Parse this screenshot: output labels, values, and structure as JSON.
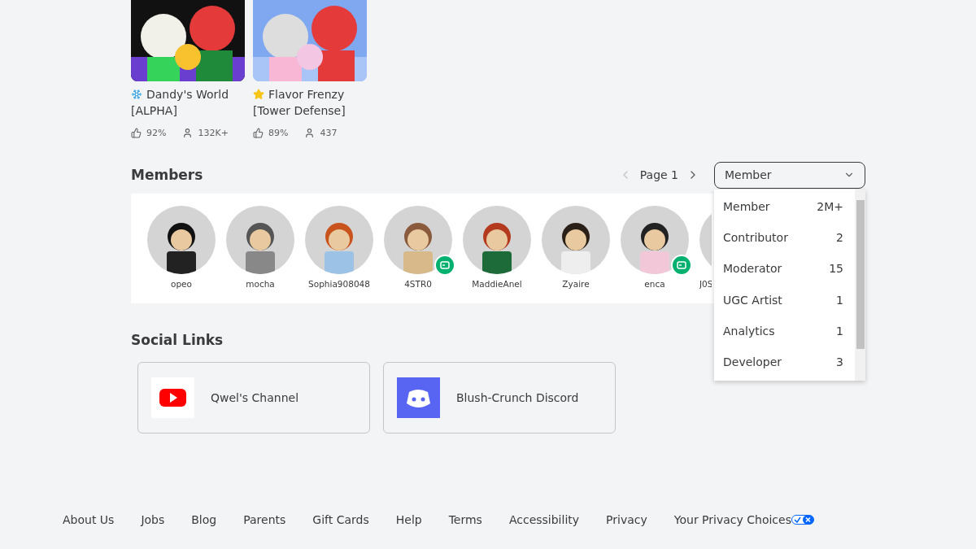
{
  "games": [
    {
      "kind": "snowflake",
      "title_line1": "Dandy's World",
      "title_line2": "[ALPHA]",
      "rating": "92%",
      "players": "132K+"
    },
    {
      "kind": "star",
      "title_line1": "Flavor Frenzy",
      "title_line2": "[Tower Defense]",
      "rating": "89%",
      "players": "437"
    }
  ],
  "members": {
    "heading": "Members",
    "pager": {
      "label": "Page 1",
      "prev_disabled": true,
      "next_disabled": false
    },
    "role_select": {
      "value": "Member",
      "expanded": true,
      "options": [
        {
          "name": "Member",
          "count": "2M+"
        },
        {
          "name": "Contributor",
          "count": "2"
        },
        {
          "name": "Moderator",
          "count": "15"
        },
        {
          "name": "UGC Artist",
          "count": "1"
        },
        {
          "name": "Analytics",
          "count": "1"
        },
        {
          "name": "Developer",
          "count": "3"
        }
      ]
    },
    "list": [
      {
        "name": "opeo",
        "in_game": false
      },
      {
        "name": "mocha",
        "in_game": false
      },
      {
        "name": "Sophia908048",
        "in_game": false
      },
      {
        "name": "4STR0",
        "in_game": true
      },
      {
        "name": "MaddieAnel",
        "in_game": false
      },
      {
        "name": "Zyaire",
        "in_game": false
      },
      {
        "name": "enca",
        "in_game": true
      },
      {
        "name": "J0S",
        "in_game": false,
        "cut": true
      }
    ]
  },
  "social_links": {
    "heading": "Social Links",
    "items": [
      {
        "kind": "youtube",
        "label": "Qwel's Channel"
      },
      {
        "kind": "discord",
        "label": "Blush-Crunch Discord"
      }
    ]
  },
  "footer": {
    "links": [
      "About Us",
      "Jobs",
      "Blog",
      "Parents",
      "Gift Cards",
      "Help",
      "Terms",
      "Accessibility",
      "Privacy",
      "Your Privacy Choices"
    ]
  }
}
